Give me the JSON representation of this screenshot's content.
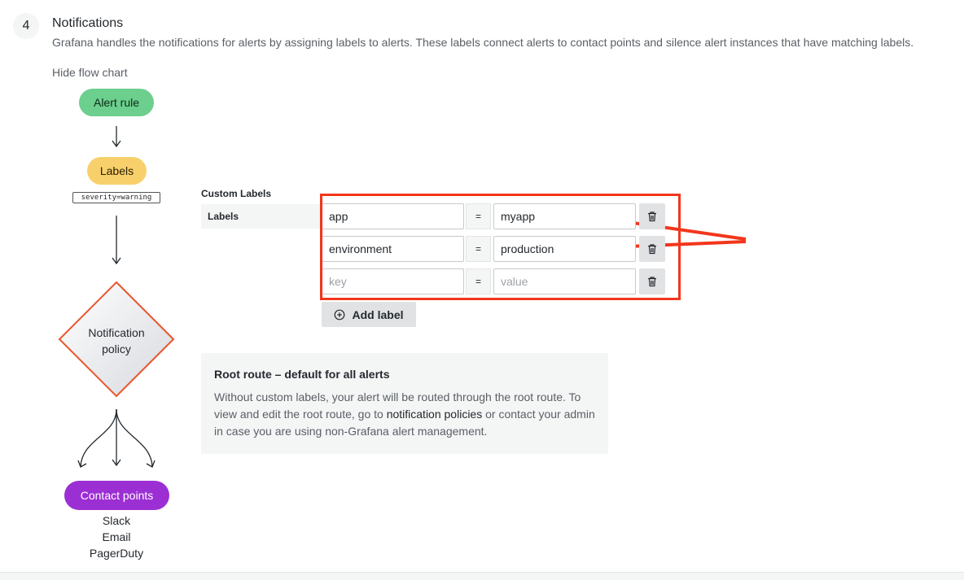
{
  "section": {
    "step_number": "4",
    "title": "Notifications",
    "description": "Grafana handles the notifications for alerts by assigning labels to alerts. These labels connect alerts to contact points and silence alert instances that have matching labels.",
    "hide_flow_link": "Hide flow chart"
  },
  "flow_chart": {
    "alert_rule": "Alert rule",
    "labels": "Labels",
    "label_example": "severity=warning",
    "notification_policy_line1": "Notification",
    "notification_policy_line2": "policy",
    "contact_points": "Contact points",
    "contact_list": [
      "Slack",
      "Email",
      "PagerDuty"
    ]
  },
  "custom_labels": {
    "title": "Custom Labels",
    "field_label": "Labels",
    "equals_sign": "=",
    "rows": [
      {
        "key": "app",
        "value": "myapp"
      },
      {
        "key": "environment",
        "value": "production"
      },
      {
        "key": "",
        "value": ""
      }
    ],
    "key_placeholder": "key",
    "value_placeholder": "value",
    "add_label_button": "Add label"
  },
  "root_route": {
    "title": "Root route – default for all alerts",
    "text_before": "Without custom labels, your alert will be routed through the root route. To view and edit the root route, go to ",
    "link": "notification policies",
    "text_after": " or contact your admin in case you are using non-Grafana alert management."
  },
  "colors": {
    "alert_rule": "#6ccf8e",
    "labels": "#f8d06b",
    "contact_points": "#9c2fd4",
    "policy_border": "#e8552e",
    "annotation_red": "#f2361c"
  },
  "icons": {
    "trash": "trash-icon",
    "add": "plus-circle-icon"
  }
}
